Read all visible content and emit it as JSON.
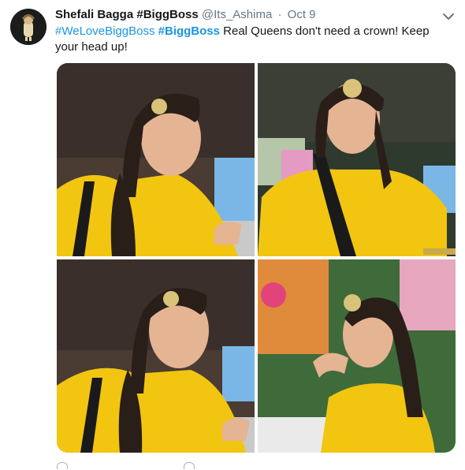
{
  "tweet": {
    "author_name": "Shefali Bagga #BiggBoss",
    "handle": "@Its_Ashima",
    "separator": "·",
    "timestamp": "Oct 9",
    "text_segments": [
      {
        "text": "#WeLoveBiggBoss",
        "kind": "hashtag"
      },
      {
        "text": " ",
        "kind": "plain"
      },
      {
        "text": "#BiggBoss",
        "kind": "hashtag-bold"
      },
      {
        "text": " Real Queens don't need a crown! Keep your head up!",
        "kind": "plain"
      }
    ],
    "images": [
      {
        "alt": "photo-1"
      },
      {
        "alt": "photo-2"
      },
      {
        "alt": "photo-3"
      },
      {
        "alt": "photo-4"
      }
    ]
  },
  "colors": {
    "link": "#1b95e0",
    "secondary_text": "#657786",
    "saree_yellow": "#f2c511"
  },
  "icons": {
    "caret": "chevron-down-icon",
    "reply": "reply-icon",
    "retweet": "retweet-icon",
    "like": "heart-icon"
  }
}
